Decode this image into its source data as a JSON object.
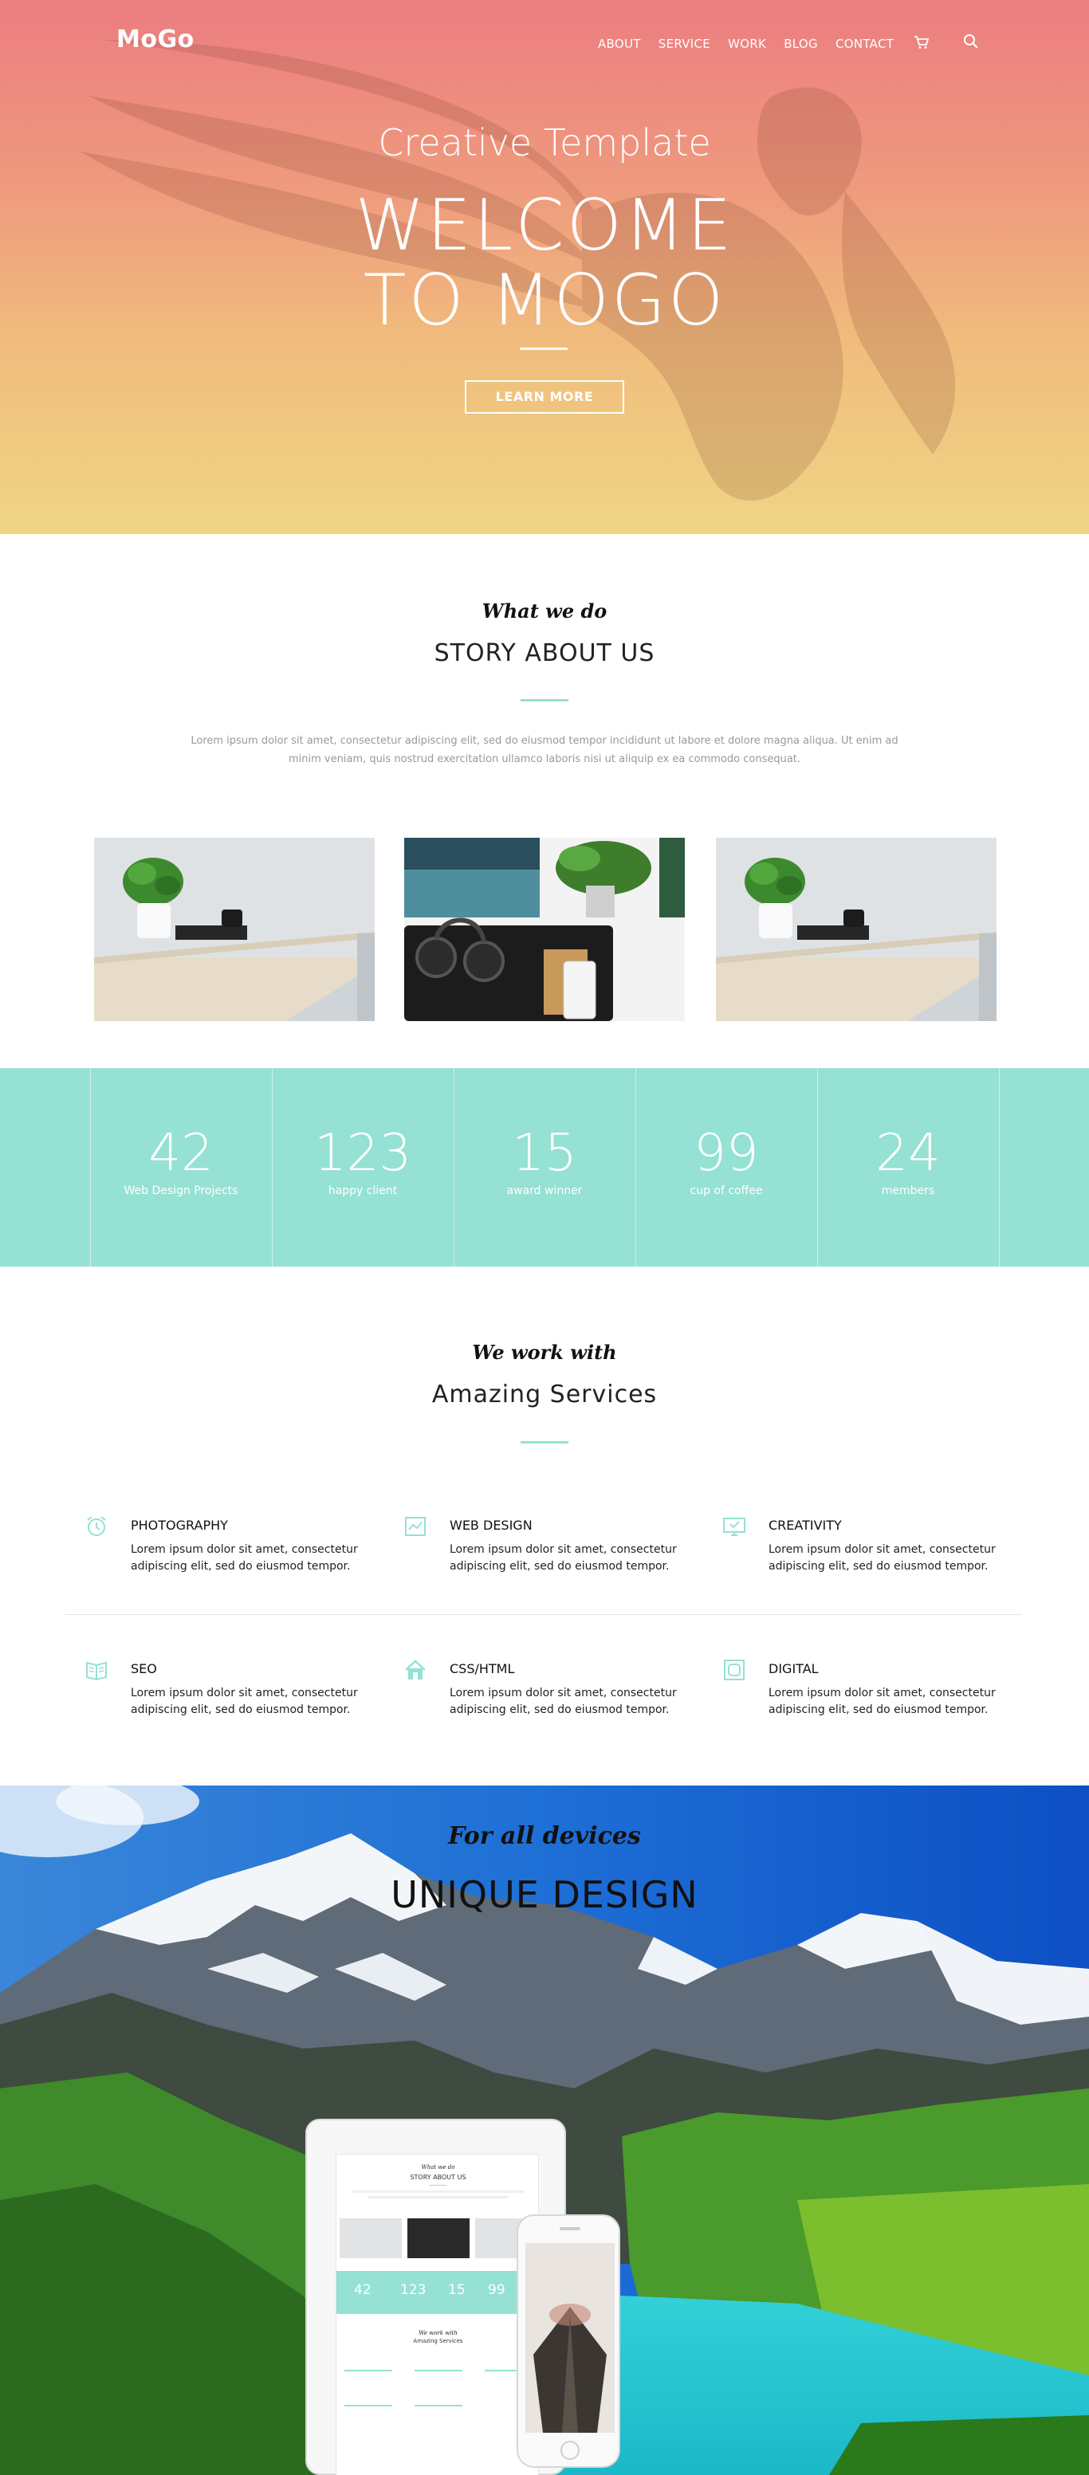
{
  "header": {
    "logo": "MoGo",
    "nav": [
      "ABOUT",
      "SERVICE",
      "WORK",
      "BLOG",
      "CONTACT"
    ],
    "cart_icon": "cart-icon",
    "search_icon": "search-icon"
  },
  "hero": {
    "subtitle": "Creative Template",
    "title_line1": "WELCOME",
    "title_line2": "TO MOGO",
    "button": "LEARN MORE"
  },
  "about": {
    "eyebrow": "What we do",
    "title": "STORY ABOUT US",
    "text": "Lorem ipsum dolor sit amet, consectetur adipiscing elit, sed do eiusmod tempor incididunt ut labore et dolore magna aliqua. Ut enim ad minim veniam, quis nostrud exercitation ullamco laboris nisi ut aliquip ex ea commodo consequat."
  },
  "stats": [
    {
      "value": "42",
      "label": "Web Design Projects"
    },
    {
      "value": "123",
      "label": "happy client"
    },
    {
      "value": "15",
      "label": "award winner"
    },
    {
      "value": "99",
      "label": "cup of coffee"
    },
    {
      "value": "24",
      "label": "members"
    }
  ],
  "services": {
    "eyebrow": "We work with",
    "title": "Amazing Services",
    "items": [
      {
        "title": "PHOTOGRAPHY",
        "desc": "Lorem ipsum dolor sit amet, consectetur adipiscing elit, sed do eiusmod tempor.",
        "icon": "alarm-clock-icon"
      },
      {
        "title": "WEB DESIGN",
        "desc": "Lorem ipsum dolor sit amet, consectetur adipiscing elit, sed do eiusmod tempor.",
        "icon": "chart-icon"
      },
      {
        "title": "CREATIVITY",
        "desc": "Lorem ipsum dolor sit amet, consectetur adipiscing elit, sed do eiusmod tempor.",
        "icon": "monitor-icon"
      },
      {
        "title": "SEO",
        "desc": "Lorem ipsum dolor sit amet, consectetur adipiscing elit, sed do eiusmod tempor.",
        "icon": "book-icon"
      },
      {
        "title": "CSS/HTML",
        "desc": "Lorem ipsum dolor sit amet, consectetur adipiscing elit, sed do eiusmod tempor.",
        "icon": "house-icon"
      },
      {
        "title": "DIGITAL",
        "desc": "Lorem ipsum dolor sit amet, consectetur adipiscing elit, sed do eiusmod tempor.",
        "icon": "frame-icon"
      }
    ]
  },
  "devices": {
    "eyebrow": "For all devices",
    "title": "UNIQUE DESIGN",
    "tablet_eyebrow": "What we do",
    "tablet_title": "STORY ABOUT US",
    "tablet_stats": [
      "42",
      "123",
      "15",
      "99"
    ],
    "tablet_svc_eyebrow": "We work with",
    "tablet_svc_title": "Amazing Services"
  },
  "colors": {
    "accent": "#95e1d3",
    "hero_top": "#ec7d80",
    "hero_bottom": "#efd584"
  }
}
